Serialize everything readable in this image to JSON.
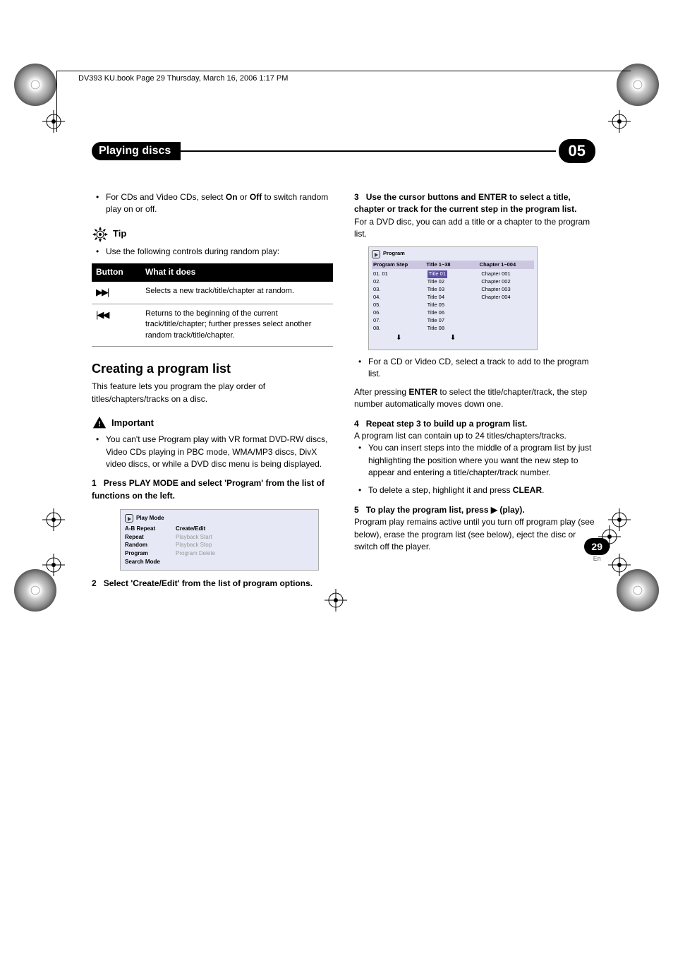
{
  "header_file_line": "DV393 KU.book  Page 29  Thursday, March 16, 2006  1:17 PM",
  "chapter": {
    "title": "Playing discs",
    "number": "05"
  },
  "left": {
    "bullet1_a": "For CDs and Video CDs, select ",
    "bullet1_on": "On",
    "bullet1_or": " or ",
    "bullet1_off": "Off",
    "bullet1_b": " to switch random play on or off.",
    "tip_label": "Tip",
    "tip_intro": "Use the following controls during random play:",
    "table": {
      "h1": "Button",
      "h2": "What it does",
      "r1c2": "Selects a new track/title/chapter at random.",
      "r2c2": "Returns to the beginning of the current track/title/chapter; further presses select another random track/title/chapter."
    },
    "heading": "Creating a program list",
    "intro": "This feature lets you program the play order of titles/chapters/tracks on a disc.",
    "important_label": "Important",
    "important_text": "You can't use Program play with VR format DVD-RW discs, Video CDs playing in PBC mode, WMA/MP3 discs, DivX video discs, or while a DVD disc menu is being displayed.",
    "step1_n": "1",
    "step1": "Press PLAY MODE and select 'Program' from the list of functions on the left.",
    "osd1": {
      "title": "Play Mode",
      "left": [
        "A-B Repeat",
        "Repeat",
        "Random",
        "Program",
        "Search Mode"
      ],
      "right": [
        "Create/Edit",
        "Playback Start",
        "Playback Stop",
        "Program Delete"
      ]
    },
    "step2_n": "2",
    "step2": "Select 'Create/Edit' from the list of program options."
  },
  "right": {
    "step3_n": "3",
    "step3": "Use the cursor buttons and ENTER to select a title, chapter or track for the current step in the program list.",
    "step3_sub": "For a DVD disc, you can add a title or a chapter to the program list.",
    "osd2": {
      "title": "Program",
      "hdr": [
        "Program Step",
        "Title 1~38",
        "Chapter 1~004"
      ],
      "steps": [
        "01. 01",
        "02.",
        "03.",
        "04.",
        "05.",
        "06.",
        "07.",
        "08."
      ],
      "titles": [
        "Title 01",
        "Title 02",
        "Title 03",
        "Title 04",
        "Title 05",
        "Title 06",
        "Title 07",
        "Title 08"
      ],
      "chapters": [
        "Chapter 001",
        "Chapter 002",
        "Chapter 003",
        "Chapter 004"
      ]
    },
    "bullet_cd": "For a CD or Video CD, select a track to add to the program list.",
    "after_a": "After pressing ",
    "after_enter": "ENTER",
    "after_b": " to select the title/chapter/track, the step number automatically moves down one.",
    "step4_n": "4",
    "step4": "Repeat step 3 to build up a program list.",
    "step4_sub": "A program list can contain up to 24 titles/chapters/tracks.",
    "bullet_insert": "You can insert steps into the middle of a program list by just highlighting the position where you want the new step to appear and entering a title/chapter/track number.",
    "bullet_delete_a": "To delete a step, highlight it and press ",
    "bullet_delete_b": "CLEAR",
    "bullet_delete_c": ".",
    "step5_n": "5",
    "step5": "To play the program list, press ▶ (play).",
    "step5_sub": "Program play remains active until you turn off program play (see below), erase the program list (see below), eject the disc or switch off the player."
  },
  "page": {
    "num": "29",
    "lang": "En"
  }
}
